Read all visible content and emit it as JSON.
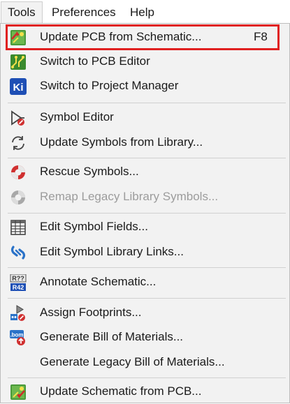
{
  "menubar": {
    "items": [
      {
        "label": "Tools",
        "active": true
      },
      {
        "label": "Preferences",
        "active": false
      },
      {
        "label": "Help",
        "active": false
      }
    ]
  },
  "menu": {
    "items": [
      {
        "label": "Update PCB from Schematic...",
        "shortcut": "F8",
        "icon": "update-pcb-icon",
        "enabled": true,
        "highlighted": true
      },
      {
        "label": "Switch to PCB Editor",
        "icon": "pcb-editor-icon",
        "enabled": true
      },
      {
        "label": "Switch to Project Manager",
        "icon": "kicad-project-manager-icon",
        "enabled": true
      },
      {
        "label": "Symbol Editor",
        "icon": "symbol-editor-icon",
        "enabled": true
      },
      {
        "label": "Update Symbols from Library...",
        "icon": "refresh-icon",
        "enabled": true
      },
      {
        "label": "Rescue Symbols...",
        "icon": "rescue-lifebuoy-icon",
        "enabled": true
      },
      {
        "label": "Remap Legacy Library Symbols...",
        "icon": "remap-lifebuoy-icon",
        "enabled": false
      },
      {
        "label": "Edit Symbol Fields...",
        "icon": "table-grid-icon",
        "enabled": true
      },
      {
        "label": "Edit Symbol Library Links...",
        "icon": "library-link-icon",
        "enabled": true
      },
      {
        "label": "Annotate Schematic...",
        "icon": "annotate-icon",
        "enabled": true
      },
      {
        "label": "Assign Footprints...",
        "icon": "assign-footprints-icon",
        "enabled": true
      },
      {
        "label": "Generate Bill of Materials...",
        "icon": "bom-icon",
        "enabled": true
      },
      {
        "label": "Generate Legacy Bill of Materials...",
        "icon": "",
        "enabled": true
      },
      {
        "label": "Update Schematic from PCB...",
        "icon": "update-schematic-icon",
        "enabled": true
      }
    ]
  },
  "icons": {
    "annotate_top": "R??",
    "annotate_bottom": "R42",
    "bom_text": ".bom",
    "kicad_text": "Ki"
  },
  "colors": {
    "highlight_border": "#e02020",
    "kicad_blue": "#1e4fb5",
    "pcb_green": "#3a9a3a",
    "rescue_red": "#d03030"
  }
}
